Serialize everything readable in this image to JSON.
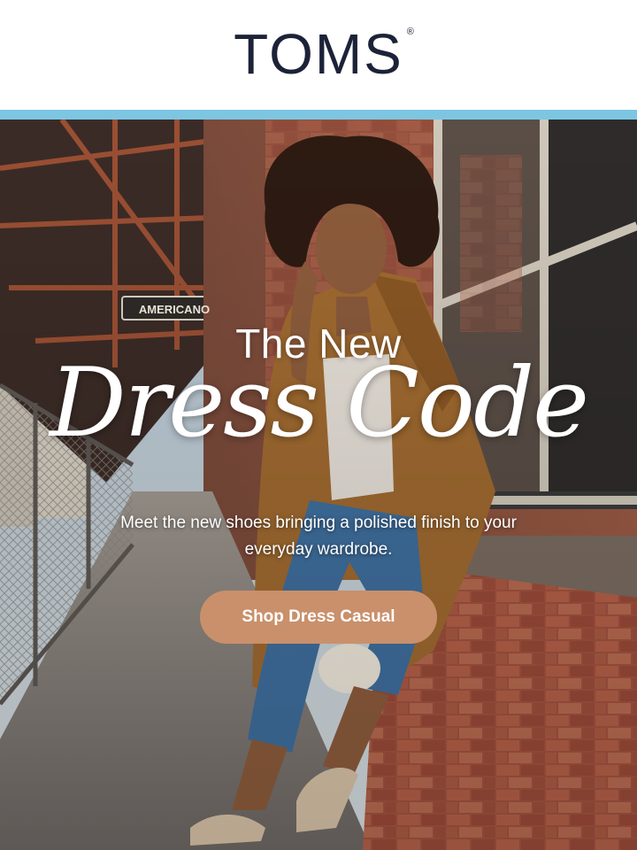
{
  "header": {
    "brand": "TOMS",
    "registered_mark": "®"
  },
  "colors": {
    "accent_bar": "#7dc6e2",
    "brand_text": "#1c2238",
    "cta_background": "#c9906b",
    "cta_text": "#ffffff"
  },
  "hero": {
    "sign_text": "AMERICANO",
    "headline_top": "The New",
    "headline_script": "Dress Code",
    "subtext": "Meet the new shoes bringing a polished finish to your everyday wardrobe.",
    "cta_label": "Shop Dress Casual"
  }
}
